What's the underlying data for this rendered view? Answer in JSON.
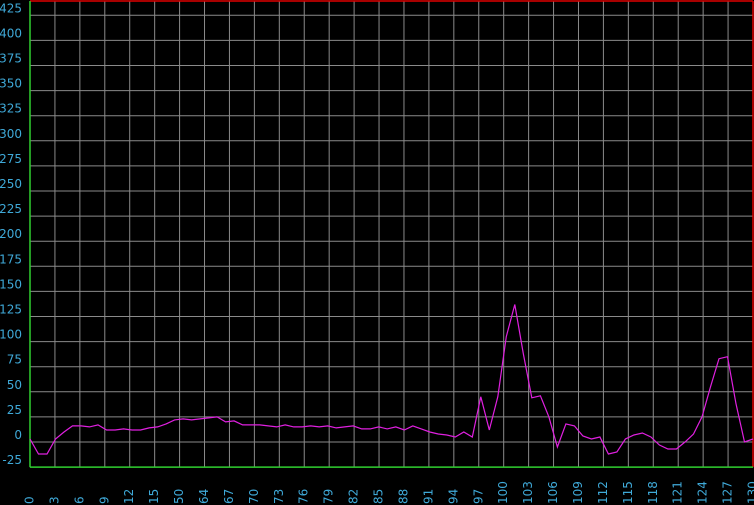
{
  "chart_data": {
    "type": "line",
    "title": "",
    "xlabel": "",
    "ylabel": "",
    "grid": true,
    "xlim": [
      0,
      130
    ],
    "ylim": [
      -25,
      435
    ],
    "y_ticks": [
      -25,
      0,
      25,
      50,
      75,
      100,
      125,
      150,
      175,
      200,
      225,
      250,
      275,
      300,
      325,
      350,
      375,
      400,
      425
    ],
    "x_ticks": [
      "0",
      "3",
      "6",
      "9",
      "12",
      "15",
      "50",
      "64",
      "67",
      "70",
      "73",
      "76",
      "79",
      "82",
      "85",
      "88",
      "91",
      "94",
      "97",
      "100",
      "103",
      "106",
      "109",
      "112",
      "115",
      "118",
      "121",
      "124",
      "127",
      "130"
    ],
    "series": [
      {
        "values": [
          3,
          -12,
          -12,
          3,
          10,
          16,
          16,
          15,
          17,
          12,
          12,
          13,
          12,
          12,
          14,
          15,
          18,
          22,
          23,
          22,
          23,
          24,
          25,
          20,
          21,
          17,
          17,
          17,
          16,
          15,
          17,
          15,
          15,
          16,
          15,
          16,
          14,
          15,
          16,
          13,
          13,
          15,
          13,
          15,
          12,
          16,
          13,
          10,
          8,
          7,
          5,
          10,
          5,
          45,
          12,
          45,
          105,
          137,
          88,
          44,
          46,
          25,
          -5,
          18,
          16,
          6,
          3,
          5,
          -12,
          -10,
          3,
          7,
          9,
          5,
          -3,
          -7,
          -7,
          0,
          8,
          25,
          55,
          83,
          85,
          38,
          0,
          3
        ]
      }
    ],
    "colors": {
      "series": "#e020e0",
      "grid": "#8a8a8a",
      "frame": "#e00000",
      "baseline": "#30d030",
      "tick_labels": "#3fa9d8",
      "background": "#000000"
    }
  }
}
